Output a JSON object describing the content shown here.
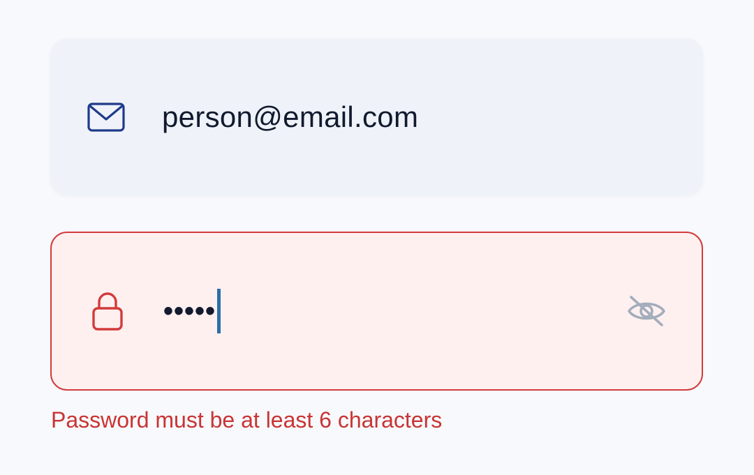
{
  "email": {
    "value": "person@email.com",
    "icon": "mail-icon"
  },
  "password": {
    "masked_value": "•••••",
    "icon": "lock-icon",
    "toggle_icon": "eye-off-icon",
    "error": "Password must be at least 6 characters"
  },
  "colors": {
    "error": "#d23b3b",
    "email_icon": "#1f3a8a",
    "caret": "#2a6fa8",
    "toggle_icon": "#a3adbb"
  }
}
